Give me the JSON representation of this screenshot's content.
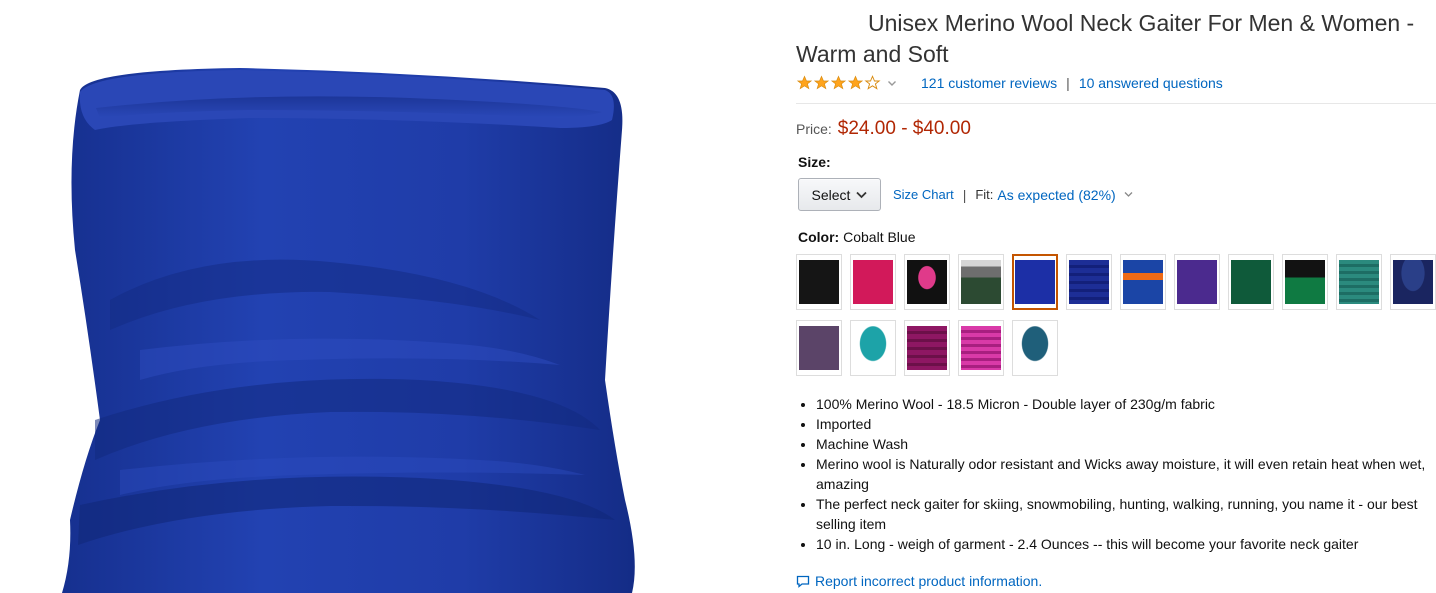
{
  "product": {
    "title_line1": "Unisex Merino Wool Neck Gaiter For Men & Women -",
    "title_line2": "Warm and Soft",
    "rating_stars": 4,
    "reviews_link": "121 customer reviews",
    "separator": "|",
    "questions_link": "10 answered questions",
    "price_label": "Price:",
    "price_value": "$24.00 - $40.00",
    "size_label": "Size:",
    "select_label": "Select",
    "size_chart_link": "Size Chart",
    "fit_label": "Fit:",
    "fit_value": "As expected (82%)",
    "color_label": "Color:",
    "color_value": "Cobalt Blue",
    "swatch_icons": [
      "black-swatch",
      "pink-swatch",
      "black-pink-swatch",
      "gray-green-swatch",
      "cobalt-blue-swatch",
      "blue-stripe-swatch",
      "blue-orange-swatch",
      "purple-swatch",
      "green-swatch",
      "black-green-swatch",
      "teal-stripe-swatch",
      "navy-swatch",
      "plum-swatch",
      "teal-swatch",
      "magenta-swatch",
      "pink-stripe-swatch",
      "dark-teal-swatch"
    ],
    "selected_color_index": 4,
    "bullets": [
      "100% Merino Wool - 18.5 Micron - Double layer of 230g/m fabric",
      "Imported",
      "Machine Wash",
      "Merino wool is Naturally odor resistant and Wicks away moisture, it will even retain heat when wet, amazing",
      "The perfect neck gaiter for skiing, snowmobiling, hunting, walking, running, you name it - our best selling item",
      "10 in. Long - weigh of garment - 2.4 Ounces -- this will become your favorite neck gaiter"
    ],
    "report_link": "Report incorrect product information."
  },
  "colors": {
    "link": "#0066c0",
    "price": "#b12704",
    "star": "#ffa41c",
    "selected_border": "#c45500",
    "gaiter_blue": "#1f3aa3"
  }
}
